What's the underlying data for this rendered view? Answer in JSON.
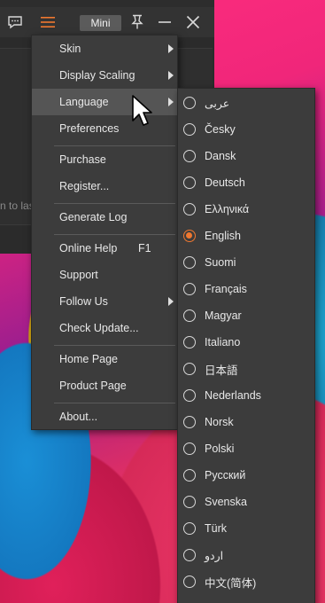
{
  "window": {
    "mini_label": "Mini",
    "hint_text": "n to las"
  },
  "menu": {
    "items": [
      {
        "label": "Skin"
      },
      {
        "label": "Display Scaling"
      },
      {
        "label": "Language"
      },
      {
        "label": "Preferences"
      },
      {
        "label": "Purchase"
      },
      {
        "label": "Register..."
      },
      {
        "label": "Generate Log"
      },
      {
        "label": "Online Help",
        "shortcut": "F1"
      },
      {
        "label": "Support"
      },
      {
        "label": "Follow Us"
      },
      {
        "label": "Check Update..."
      },
      {
        "label": "Home Page"
      },
      {
        "label": "Product Page"
      },
      {
        "label": "About..."
      }
    ]
  },
  "languages": {
    "selected": "English",
    "items": [
      {
        "label": "عربى"
      },
      {
        "label": "Česky"
      },
      {
        "label": "Dansk"
      },
      {
        "label": "Deutsch"
      },
      {
        "label": "Ελληνικά"
      },
      {
        "label": "English"
      },
      {
        "label": "Suomi"
      },
      {
        "label": "Français"
      },
      {
        "label": "Magyar"
      },
      {
        "label": "Italiano"
      },
      {
        "label": "日本語"
      },
      {
        "label": "Nederlands"
      },
      {
        "label": "Norsk"
      },
      {
        "label": "Polski"
      },
      {
        "label": "Русский"
      },
      {
        "label": "Svenska"
      },
      {
        "label": "Türk"
      },
      {
        "label": "اردو"
      },
      {
        "label": "中文(简体)"
      }
    ]
  },
  "colors": {
    "accent": "#f07830",
    "menu_bg": "#3c3c3c",
    "menu_hover": "#555555"
  }
}
